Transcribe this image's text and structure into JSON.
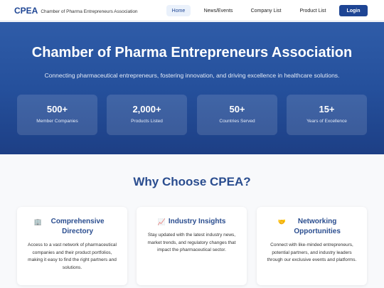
{
  "header": {
    "brand_abbr": "CPEA",
    "brand_name": "Chamber of Pharma Entrepreneurs Association",
    "nav": [
      "Home",
      "News/Events",
      "Company List",
      "Product List"
    ],
    "login_label": "Login"
  },
  "hero": {
    "title": "Chamber of Pharma Entrepreneurs Association",
    "subtitle": "Connecting pharmaceutical entrepreneurs, fostering innovation, and driving excellence in healthcare solutions.",
    "stats": [
      {
        "value": "500+",
        "label": "Member Companies"
      },
      {
        "value": "2,000+",
        "label": "Products Listed"
      },
      {
        "value": "50+",
        "label": "Countries Served"
      },
      {
        "value": "15+",
        "label": "Years of Excellence"
      }
    ]
  },
  "why": {
    "title": "Why Choose CPEA?",
    "cards": [
      {
        "icon": "🏢",
        "icon_name": "office-building-icon",
        "title": "Comprehensive Directory",
        "text": "Access to a vast network of pharmaceutical companies and their product portfolios, making it easy to find the right partners and solutions."
      },
      {
        "icon": "📈",
        "icon_name": "chart-increasing-icon",
        "title": "Industry Insights",
        "text": "Stay updated with the latest industry news, market trends, and regulatory changes that impact the pharmaceutical sector."
      },
      {
        "icon": "🤝",
        "icon_name": "handshake-icon",
        "title": "Networking Opportunities",
        "text": "Connect with like-minded entrepreneurs, potential partners, and industry leaders through our exclusive events and platforms."
      }
    ]
  }
}
